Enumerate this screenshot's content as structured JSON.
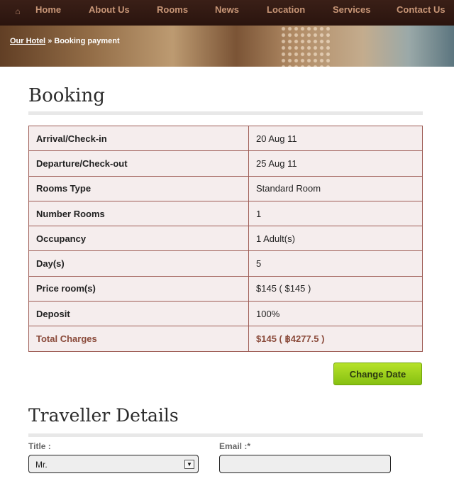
{
  "nav": {
    "items": [
      "Home",
      "About Us",
      "Rooms",
      "News",
      "Location",
      "Services",
      "Contact Us"
    ]
  },
  "breadcrumb": {
    "link": "Our Hotel",
    "separator": "»",
    "current": "Booking payment"
  },
  "booking": {
    "title": "Booking",
    "rows": [
      {
        "label": "Arrival/Check-in",
        "value": "20 Aug 11"
      },
      {
        "label": "Departure/Check-out",
        "value": "25 Aug 11"
      },
      {
        "label": "Rooms Type",
        "value": "Standard Room"
      },
      {
        "label": "Number Rooms",
        "value": "1"
      },
      {
        "label": "Occupancy",
        "value": "1 Adult(s)"
      },
      {
        "label": "Day(s)",
        "value": "5"
      },
      {
        "label": "Price room(s)",
        "value": "$145 ( $145 )"
      },
      {
        "label": "Deposit",
        "value": "100%"
      },
      {
        "label": "Total Charges",
        "value": "$145 ( ฿4277.5 )"
      }
    ],
    "change_date_label": "Change Date"
  },
  "traveller": {
    "title": "Traveller Details",
    "title_label": "Title :",
    "title_value": "Mr.",
    "email_label": "Email :*"
  },
  "colors": {
    "nav_bg": "#2a140e",
    "nav_text": "#c89677",
    "table_border": "#9e5c55",
    "table_bg": "#f5eded",
    "total_text": "#8a4a3a",
    "button_green": "#9fd21c"
  }
}
